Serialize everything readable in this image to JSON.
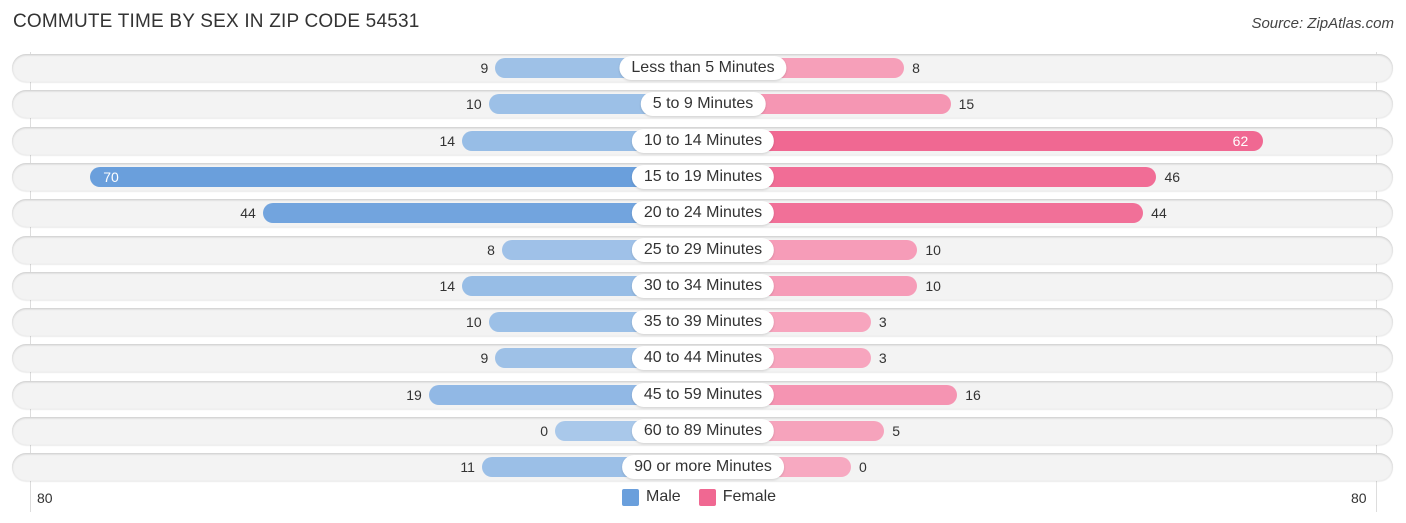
{
  "title": "COMMUTE TIME BY SEX IN ZIP CODE 54531",
  "source": "Source: ZipAtlas.com",
  "colors": {
    "male": "#6a9fdc",
    "male_light": "#a9c8ea",
    "female": "#f06892",
    "female_light": "#f7a9c1"
  },
  "chart_data": {
    "type": "bar",
    "orientation": "horizontal-diverging",
    "title": "COMMUTE TIME BY SEX IN ZIP CODE 54531",
    "categories": [
      "Less than 5 Minutes",
      "5 to 9 Minutes",
      "10 to 14 Minutes",
      "15 to 19 Minutes",
      "20 to 24 Minutes",
      "25 to 29 Minutes",
      "30 to 34 Minutes",
      "35 to 39 Minutes",
      "40 to 44 Minutes",
      "45 to 59 Minutes",
      "60 to 89 Minutes",
      "90 or more Minutes"
    ],
    "series": [
      {
        "name": "Male",
        "values": [
          9,
          10,
          14,
          70,
          44,
          8,
          14,
          10,
          9,
          19,
          0,
          11
        ]
      },
      {
        "name": "Female",
        "values": [
          8,
          15,
          62,
          46,
          44,
          10,
          10,
          3,
          3,
          16,
          5,
          0
        ]
      }
    ],
    "axis": {
      "left_label": "80",
      "right_label": "80",
      "max": 80
    },
    "legend": [
      "Male",
      "Female"
    ],
    "legend_position": "bottom-center"
  }
}
